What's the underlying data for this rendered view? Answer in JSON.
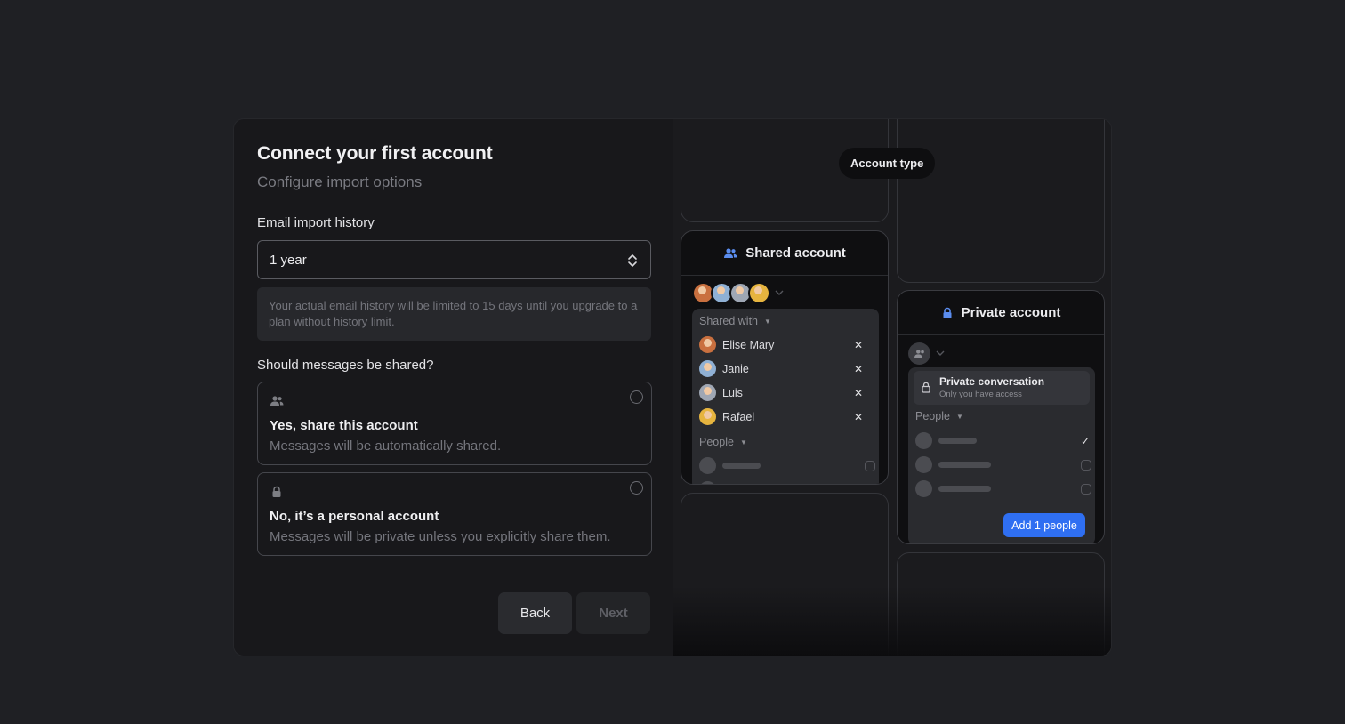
{
  "header": {
    "title": "Connect your first account",
    "subtitle": "Configure import options"
  },
  "email_history": {
    "label": "Email import history",
    "value": "1 year",
    "note": "Your actual email history will be limited to 15 days until you upgrade to a plan without history limit."
  },
  "sharing": {
    "label": "Should messages be shared?",
    "options": [
      {
        "title": "Yes, share this account",
        "description": "Messages will be automatically shared.",
        "icon": "people-icon"
      },
      {
        "title": "No, it’s a personal account",
        "description": "Messages will be private unless you explicitly share them.",
        "icon": "lock-icon"
      }
    ]
  },
  "footer": {
    "back_label": "Back",
    "next_label": "Next"
  },
  "preview": {
    "pill_label": "Account type",
    "shared_card": {
      "title": "Shared account",
      "shared_with_label": "Shared with",
      "members": [
        "Elise Mary",
        "Janie",
        "Luis",
        "Rafael"
      ],
      "people_label": "People"
    },
    "private_card": {
      "title": "Private account",
      "conversation_title": "Private conversation",
      "conversation_subtitle": "Only you have access",
      "people_label": "People",
      "add_button": "Add 1 people"
    }
  },
  "colors": {
    "accent": "#2f6ff2",
    "background": "#1f2024",
    "panel": "#18181b"
  }
}
